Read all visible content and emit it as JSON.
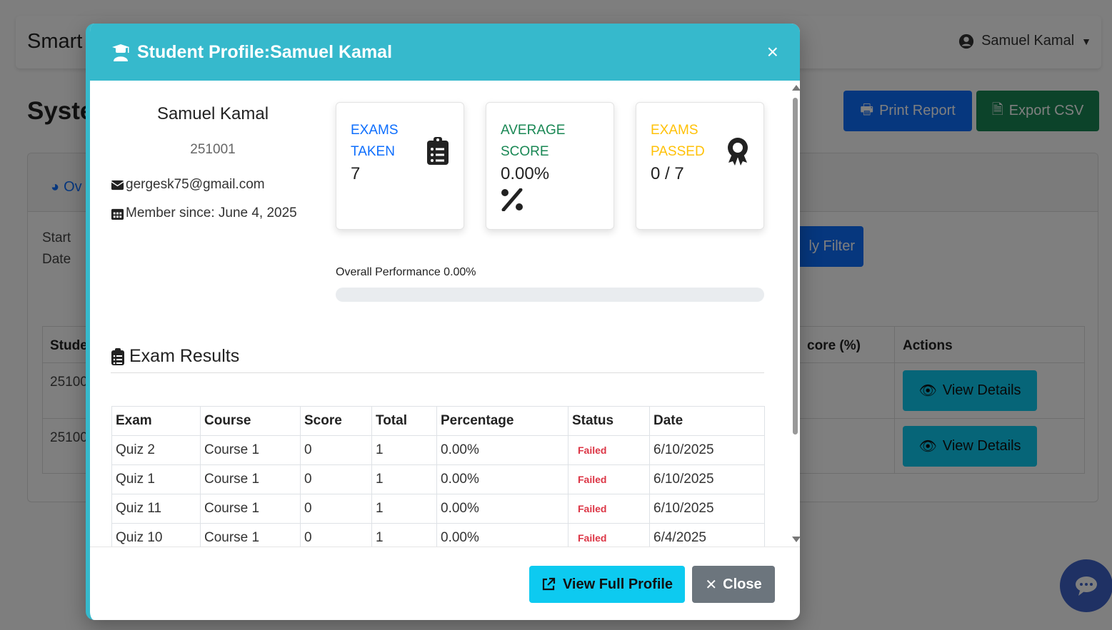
{
  "background": {
    "brand": "Smart",
    "user_name": "Samuel Kamal",
    "page_title": "Syste",
    "print_label": "Print Report",
    "export_label": "Export CSV",
    "tab_label": "Ov",
    "start_date_label": "Start Date",
    "filter_label": "ly Filter",
    "table_headers": [
      "Stude",
      "core (%)",
      "Actions"
    ],
    "rows": [
      "25100",
      "25100"
    ],
    "view_details_label": "View Details"
  },
  "modal": {
    "title": "Student Profile:Samuel Kamal",
    "close_x": "×",
    "profile": {
      "name": "Samuel Kamal",
      "id": "251001",
      "email": "gergesk75@gmail.com",
      "member_since": "Member since: June 4, 2025"
    },
    "stats": [
      {
        "label": "EXAMS TAKEN",
        "value": "7",
        "color": "#0d6efd",
        "icon": "clipboard-list-icon"
      },
      {
        "label": "AVERAGE SCORE",
        "value": "0.00%",
        "color": "#198754",
        "icon": "percent-icon"
      },
      {
        "label": "EXAMS PASSED",
        "value": "0 / 7",
        "color": "#ffc107",
        "icon": "award-icon"
      }
    ],
    "performance": {
      "label": "Overall Performance 0.00%",
      "value": 0
    },
    "results": {
      "title": "Exam Results",
      "headers": [
        "Exam",
        "Course",
        "Score",
        "Total",
        "Percentage",
        "Status",
        "Date"
      ],
      "rows": [
        [
          "Quiz 2",
          "Course 1",
          "0",
          "1",
          "0.00%",
          "Failed",
          "6/10/2025"
        ],
        [
          "Quiz 1",
          "Course 1",
          "0",
          "1",
          "0.00%",
          "Failed",
          "6/10/2025"
        ],
        [
          "Quiz 11",
          "Course 1",
          "0",
          "1",
          "0.00%",
          "Failed",
          "6/10/2025"
        ],
        [
          "Quiz 10",
          "Course 1",
          "0",
          "1",
          "0.00%",
          "Failed",
          "6/4/2025"
        ]
      ]
    },
    "footer": {
      "view_full_label": "View Full Profile",
      "close_label": "Close"
    }
  }
}
